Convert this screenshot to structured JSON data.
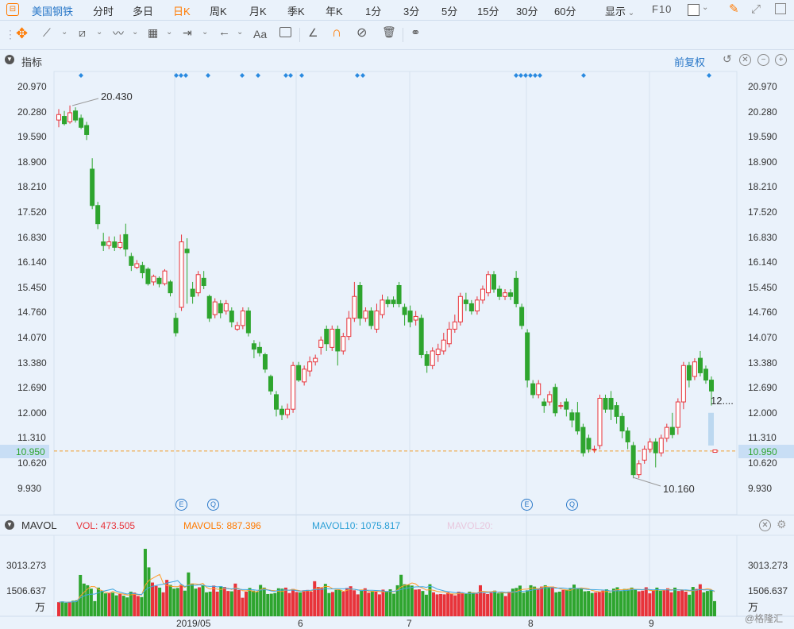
{
  "period_bar": {
    "stock_name": "美国钢铁",
    "periods": [
      "分时",
      "多日",
      "日K",
      "周K",
      "月K",
      "季K",
      "年K",
      "1分",
      "3分",
      "5分",
      "15分",
      "30分",
      "60分"
    ],
    "active_period": "日K",
    "display_label": "显示",
    "f10_label": "F10"
  },
  "toolbar": {
    "text_tool_label": "Aa"
  },
  "indicator_panel": {
    "title": "指标",
    "adjust_label": "前复权"
  },
  "price_axis": {
    "ticks": [
      "20.970",
      "20.280",
      "19.590",
      "18.900",
      "18.210",
      "17.520",
      "16.830",
      "16.140",
      "15.450",
      "14.760",
      "14.070",
      "13.380",
      "12.690",
      "12.000",
      "11.310",
      "10.620",
      "9.930"
    ],
    "current_price": "10.950",
    "high_label": "20.430",
    "low_label": "10.160",
    "last_label": "12...."
  },
  "markers": {
    "event_e": "E",
    "event_q": "Q"
  },
  "volume_panel": {
    "title": "MAVOL",
    "vol_label": "VOL: 473.505",
    "mavol5_label": "MAVOL5: 887.396",
    "mavol10_label": "MAVOL10: 1075.817",
    "mavol20_label": "MAVOL20:",
    "ticks": [
      "3013.273",
      "1506.637"
    ],
    "unit": "万"
  },
  "time_axis": {
    "labels": [
      "2019/05",
      "6",
      "7",
      "8",
      "9"
    ]
  },
  "watermark": "@格隆汇",
  "colors": {
    "up": "#e8333a",
    "down": "#2ea52e",
    "accent": "#ff7a00",
    "blue": "#2a78c8",
    "current_price_bg": "#c8def5"
  },
  "candles": [
    [
      20.05,
      20.2,
      19.85,
      20.35
    ],
    [
      20.15,
      19.95,
      19.9,
      20.3
    ],
    [
      20.0,
      20.25,
      19.95,
      20.45
    ],
    [
      20.3,
      20.05,
      19.98,
      20.4
    ],
    [
      20.1,
      19.85,
      19.8,
      20.2
    ],
    [
      19.9,
      19.65,
      19.5,
      20.0
    ],
    [
      18.7,
      17.7,
      17.6,
      19.0
    ],
    [
      17.7,
      17.2,
      17.05,
      17.8
    ],
    [
      16.7,
      16.6,
      16.45,
      16.95
    ],
    [
      16.6,
      16.7,
      16.5,
      16.85
    ],
    [
      16.7,
      16.55,
      16.45,
      16.85
    ],
    [
      16.55,
      16.68,
      16.5,
      16.9
    ],
    [
      16.9,
      16.5,
      16.3,
      17.2
    ],
    [
      16.3,
      16.05,
      15.9,
      16.4
    ],
    [
      16.0,
      16.1,
      15.95,
      16.2
    ],
    [
      16.05,
      15.85,
      15.7,
      16.15
    ],
    [
      15.95,
      15.55,
      15.5,
      16.0
    ],
    [
      15.6,
      15.75,
      15.5,
      15.8
    ],
    [
      15.7,
      15.55,
      15.45,
      15.75
    ],
    [
      15.55,
      15.9,
      15.5,
      15.95
    ],
    [
      15.6,
      15.3,
      15.2,
      15.65
    ],
    [
      14.6,
      14.2,
      14.1,
      14.75
    ],
    [
      14.9,
      16.7,
      14.8,
      16.9
    ],
    [
      16.5,
      16.4,
      15.0,
      16.8
    ],
    [
      15.4,
      15.2,
      15.0,
      15.6
    ],
    [
      15.3,
      15.8,
      15.2,
      15.9
    ],
    [
      15.7,
      15.5,
      15.4,
      15.9
    ],
    [
      15.2,
      14.6,
      14.5,
      15.25
    ],
    [
      14.7,
      15.05,
      14.6,
      15.15
    ],
    [
      15.0,
      14.75,
      14.6,
      15.1
    ],
    [
      14.8,
      15.0,
      14.7,
      15.1
    ],
    [
      14.8,
      14.5,
      14.35,
      14.9
    ],
    [
      14.3,
      14.4,
      14.25,
      14.5
    ],
    [
      14.4,
      14.8,
      14.3,
      14.9
    ],
    [
      14.8,
      14.2,
      14.1,
      14.9
    ],
    [
      13.9,
      13.75,
      13.5,
      14.0
    ],
    [
      13.8,
      13.65,
      13.55,
      13.95
    ],
    [
      13.6,
      13.2,
      13.1,
      13.65
    ],
    [
      13.0,
      12.6,
      12.5,
      13.05
    ],
    [
      12.5,
      12.1,
      11.9,
      12.6
    ],
    [
      12.1,
      11.95,
      11.8,
      12.2
    ],
    [
      11.95,
      12.1,
      11.85,
      12.25
    ],
    [
      12.1,
      13.3,
      12.0,
      13.4
    ],
    [
      13.3,
      12.9,
      12.85,
      13.4
    ],
    [
      12.85,
      13.2,
      12.75,
      13.3
    ],
    [
      13.15,
      13.4,
      13.0,
      13.55
    ],
    [
      13.4,
      13.5,
      13.3,
      13.6
    ],
    [
      13.8,
      14.0,
      13.6,
      14.1
    ],
    [
      14.3,
      13.9,
      13.7,
      14.4
    ],
    [
      13.8,
      14.3,
      13.7,
      14.4
    ],
    [
      14.3,
      13.7,
      13.3,
      14.4
    ],
    [
      13.7,
      14.1,
      13.6,
      14.2
    ],
    [
      14.1,
      14.6,
      14.0,
      14.8
    ],
    [
      14.6,
      15.2,
      14.5,
      15.6
    ],
    [
      15.5,
      14.6,
      14.4,
      15.6
    ],
    [
      14.6,
      14.8,
      14.5,
      14.9
    ],
    [
      14.8,
      14.4,
      14.3,
      14.9
    ],
    [
      14.3,
      14.8,
      14.2,
      15.0
    ],
    [
      14.7,
      15.1,
      14.6,
      15.25
    ],
    [
      15.1,
      15.0,
      14.9,
      15.2
    ],
    [
      15.1,
      15.0,
      14.9,
      15.2
    ],
    [
      15.5,
      15.0,
      14.9,
      15.6
    ],
    [
      14.9,
      14.7,
      14.4,
      15.0
    ],
    [
      14.8,
      14.5,
      14.35,
      14.95
    ],
    [
      14.55,
      14.65,
      14.4,
      14.8
    ],
    [
      14.6,
      13.6,
      13.5,
      14.7
    ],
    [
      13.6,
      13.3,
      13.1,
      13.7
    ],
    [
      13.3,
      13.7,
      13.2,
      13.8
    ],
    [
      13.6,
      13.75,
      13.4,
      13.9
    ],
    [
      13.7,
      14.0,
      13.6,
      14.2
    ],
    [
      13.9,
      14.3,
      13.8,
      14.5
    ],
    [
      14.3,
      14.5,
      14.2,
      14.7
    ],
    [
      14.5,
      15.2,
      14.4,
      15.3
    ],
    [
      15.1,
      15.0,
      14.8,
      15.3
    ],
    [
      15.0,
      14.8,
      14.7,
      15.1
    ],
    [
      14.8,
      15.1,
      14.7,
      15.2
    ],
    [
      15.1,
      15.4,
      15.0,
      15.5
    ],
    [
      15.3,
      15.8,
      15.2,
      15.9
    ],
    [
      15.8,
      15.4,
      15.3,
      15.9
    ],
    [
      15.4,
      15.2,
      15.1,
      15.5
    ],
    [
      15.2,
      15.3,
      15.1,
      15.4
    ],
    [
      15.3,
      15.2,
      15.1,
      15.4
    ],
    [
      15.7,
      15.0,
      14.9,
      15.9
    ],
    [
      14.9,
      14.4,
      14.3,
      15.0
    ],
    [
      14.2,
      12.9,
      12.7,
      14.3
    ],
    [
      12.8,
      12.5,
      12.4,
      12.9
    ],
    [
      12.5,
      12.8,
      12.4,
      12.9
    ],
    [
      12.3,
      12.2,
      12.0,
      12.4
    ],
    [
      12.3,
      12.5,
      12.2,
      12.6
    ],
    [
      12.7,
      12.0,
      11.9,
      12.8
    ],
    [
      12.2,
      12.2,
      12.1,
      12.3
    ],
    [
      12.3,
      12.1,
      11.9,
      12.4
    ],
    [
      12.0,
      11.8,
      11.6,
      12.1
    ],
    [
      12.0,
      11.5,
      11.4,
      12.3
    ],
    [
      11.6,
      10.9,
      10.8,
      11.7
    ],
    [
      11.3,
      11.0,
      10.9,
      11.4
    ],
    [
      11.0,
      11.0,
      10.9,
      11.1
    ],
    [
      11.1,
      12.4,
      11.0,
      12.5
    ],
    [
      12.4,
      12.1,
      12.0,
      12.5
    ],
    [
      12.4,
      12.1,
      11.8,
      12.6
    ],
    [
      12.2,
      11.9,
      11.7,
      12.3
    ],
    [
      11.9,
      11.5,
      11.3,
      12.0
    ],
    [
      11.5,
      11.2,
      11.0,
      11.6
    ],
    [
      11.1,
      10.3,
      10.2,
      11.2
    ],
    [
      10.3,
      10.6,
      10.2,
      10.7
    ],
    [
      10.7,
      11.0,
      10.6,
      11.1
    ],
    [
      11.0,
      11.2,
      10.9,
      11.3
    ],
    [
      11.2,
      10.9,
      10.5,
      11.3
    ],
    [
      10.9,
      11.3,
      10.8,
      11.4
    ],
    [
      11.3,
      11.6,
      11.2,
      11.7
    ],
    [
      11.6,
      11.4,
      11.3,
      12.0
    ],
    [
      11.6,
      12.3,
      11.4,
      12.4
    ],
    [
      12.3,
      13.3,
      12.1,
      13.4
    ],
    [
      13.3,
      12.9,
      12.7,
      13.4
    ],
    [
      13.0,
      13.4,
      12.9,
      13.5
    ],
    [
      13.5,
      13.1,
      13.0,
      13.7
    ],
    [
      13.2,
      12.9,
      12.8,
      13.3
    ],
    [
      12.9,
      12.6,
      12.2,
      13.0
    ]
  ],
  "volumes": [
    840,
    880,
    800,
    860,
    920,
    950,
    2450,
    1940,
    1840,
    1640,
    900,
    1700,
    1520,
    1360,
    1380,
    1400,
    1240,
    1320,
    1220,
    1120,
    1460,
    1400,
    1200,
    1140,
    4000,
    2900,
    2000,
    1800,
    1700,
    1420,
    2160,
    1860,
    1640,
    1680,
    1880,
    1520,
    2600,
    1940,
    1640,
    1720,
    1860,
    1420,
    1460,
    1820,
    1460,
    1780,
    1740,
    1500,
    1480,
    1940,
    1560,
    1100,
    1460,
    1680,
    1520,
    1460,
    1860,
    1700,
    1320,
    1340,
    1380,
    1660,
    1640,
    1700,
    1380,
    1620,
    1440,
    1420,
    1540,
    1560,
    1460,
    2080,
    1740,
    1680,
    1920,
    1380,
    1440,
    1560,
    1560,
    1460,
    1680,
    1780,
    1540,
    1300,
    1520,
    1660,
    1400,
    1500,
    1460,
    1300,
    1580,
    1460,
    1600,
    1340,
    1840,
    2460,
    1900,
    1860,
    1820,
    1580,
    1600,
    1500,
    1280,
    1900,
    1420,
    1300,
    1320,
    1300,
    1420,
    1320,
    1240,
    1460,
    1380,
    1320,
    1460,
    1400,
    1340,
    1840,
    1380,
    1320,
    1400,
    1520,
    1360,
    1420,
    1200,
    1460,
    1640,
    1680,
    1820,
    1400,
    1540,
    1840,
    1760,
    1620,
    1760,
    1840,
    1740,
    1760,
    1420,
    1460,
    1560,
    1580,
    1680,
    1880,
    1620,
    1660,
    1480,
    1500,
    1380,
    1420,
    1460,
    1520,
    1600,
    1400,
    1640,
    1720,
    1500,
    1620,
    1580,
    1700,
    1600,
    1480,
    1520,
    1720,
    1360,
    1540,
    1700,
    1520,
    1580,
    1660,
    1420,
    1700,
    1500,
    1580,
    1460,
    1280,
    1740,
    1620,
    1900,
    1420,
    1500,
    1540,
    900
  ]
}
